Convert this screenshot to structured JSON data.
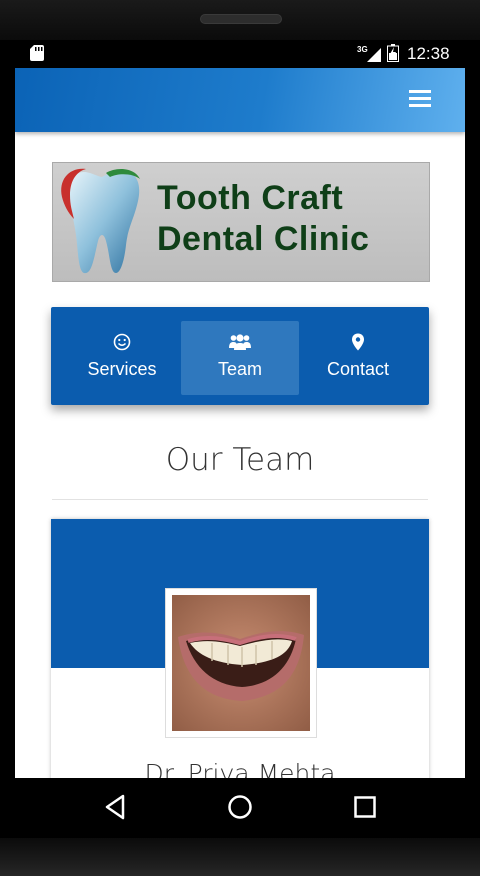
{
  "status_bar": {
    "time": "12:38",
    "network": "3G",
    "icons": [
      "sd-card-icon",
      "signal-icon",
      "battery-icon"
    ]
  },
  "app_bar": {
    "menu_icon": "hamburger-menu-icon"
  },
  "logo": {
    "line1": "Tooth Craft",
    "line2": "Dental Clinic",
    "icon": "tooth-icon"
  },
  "nav": {
    "items": [
      {
        "label": "Services",
        "icon": "smile-icon",
        "active": false
      },
      {
        "label": "Team",
        "icon": "users-icon",
        "active": true
      },
      {
        "label": "Contact",
        "icon": "map-pin-icon",
        "active": false
      }
    ]
  },
  "section": {
    "title": "Our Team"
  },
  "team": {
    "members": [
      {
        "name": "Dr. Priya Mehta",
        "photo": "smile-photo"
      }
    ]
  },
  "system_nav": {
    "buttons": [
      "back-icon",
      "home-icon",
      "recents-icon"
    ]
  },
  "colors": {
    "primary": "#0b5cae",
    "nav_active": "#2f78be",
    "logo_text": "#0f3f18"
  }
}
